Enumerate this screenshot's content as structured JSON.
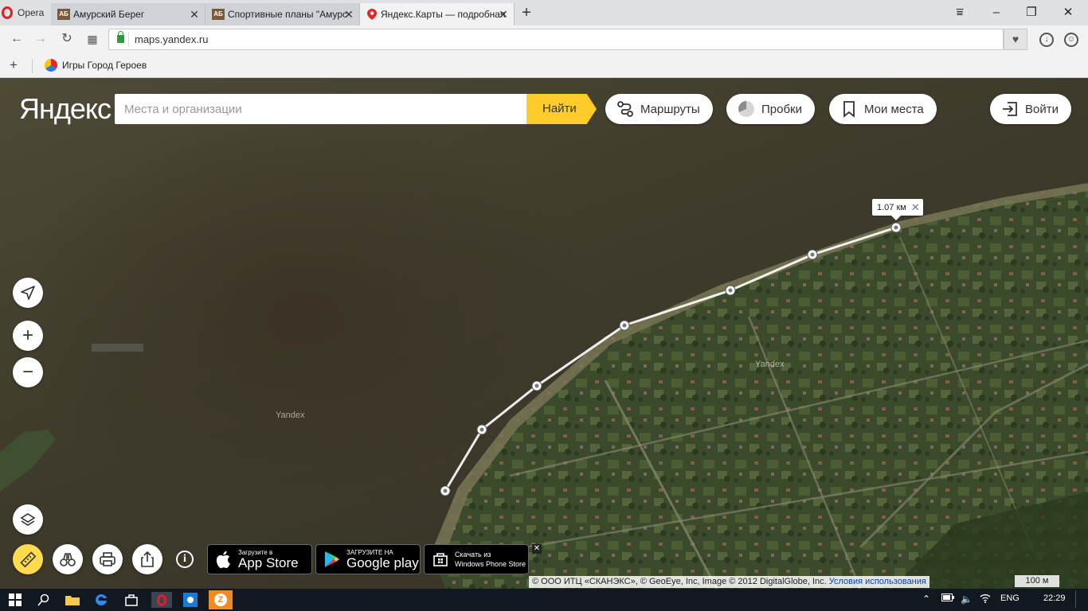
{
  "browser": {
    "menu_label": "Opera",
    "tabs": [
      {
        "label": "Амурский Берег",
        "favicon": "АБ"
      },
      {
        "label": "Спортивные планы \"Амурс",
        "favicon": "АБ"
      },
      {
        "label": "Яндекс.Карты — подробная",
        "favicon": "map-pin-icon"
      }
    ],
    "url": "maps.yandex.ru",
    "bookmarks": [
      {
        "label": "Игры Город Героев"
      }
    ]
  },
  "yandex": {
    "logo": "Яндекс",
    "search_placeholder": "Места и организации",
    "find_label": "Найти",
    "buttons": {
      "routes": "Маршруты",
      "traffic": "Пробки",
      "my_places": "Мои места",
      "login": "Войти"
    }
  },
  "map": {
    "distance_label": "1.07 км",
    "watermarks": [
      "Yandex",
      "Yandex"
    ],
    "copyright_text": "© ООО ИТЦ «СКАНЭКС», © GeoEye, Inc, Image © 2012 DigitalGlobe, Inc.",
    "terms_link": "Условия использования",
    "scale_label": "100 м",
    "colors": {
      "route_line": "#ffffff",
      "ruler_button": "#ffdb4d",
      "find_button": "#ffcc29"
    }
  },
  "stores": {
    "appstore": {
      "small": "Загрузите в",
      "big": "App Store"
    },
    "googleplay": {
      "small": "ЗАГРУЗИТЕ НА",
      "big": "Google play"
    },
    "windows": {
      "small": "Скачать из",
      "big": "Windows Phone Store"
    }
  },
  "taskbar": {
    "language": "ENG",
    "time": "22:29"
  }
}
